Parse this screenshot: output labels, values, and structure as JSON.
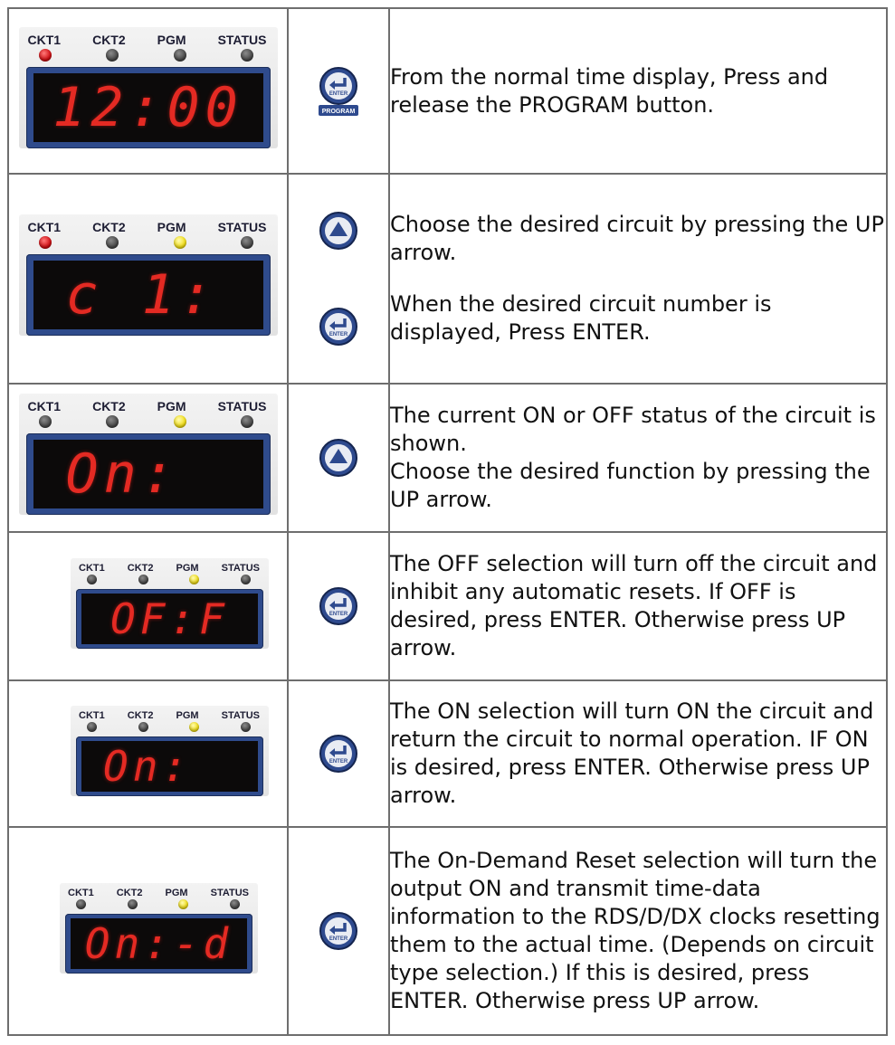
{
  "panel_labels": {
    "ckt1": "CKT1",
    "ckt2": "CKT2",
    "pgm": "PGM",
    "status": "STATUS"
  },
  "colors": {
    "led_red": "#d10f14",
    "led_yellow": "#f3e018",
    "led_off": "#4a4a4a",
    "bezel": "#2f4b8c",
    "digit_red": "#e42a23",
    "button_blue": "#2e4a8e"
  },
  "icons": {
    "enter": "enter-button-icon",
    "up": "up-arrow-button-icon",
    "program": "enter-program-button-icon"
  },
  "button_labels": {
    "enter": "ENTER",
    "program": "PROGRAM"
  },
  "steps": [
    {
      "display": "12:00",
      "leds": [
        "red",
        "off",
        "off",
        "off"
      ],
      "buttons": [
        "program"
      ],
      "text": [
        "From the normal time display, Press and release the PROGRAM button."
      ]
    },
    {
      "display": "c 1:",
      "leds": [
        "red",
        "off",
        "yellow",
        "off"
      ],
      "buttons": [
        "up",
        "enter"
      ],
      "text": [
        "Choose the desired circuit by pressing the UP arrow.",
        "When the desired circuit number is displayed, Press ENTER."
      ]
    },
    {
      "display": "On:",
      "leds": [
        "off",
        "off",
        "yellow",
        "off"
      ],
      "buttons": [
        "up"
      ],
      "text": [
        "The current ON or OFF status of the circuit is shown.",
        "Choose the desired function by pressing the UP arrow."
      ]
    },
    {
      "display": "OF:F",
      "leds": [
        "off",
        "off",
        "yellow",
        "off"
      ],
      "buttons": [
        "enter"
      ],
      "text": [
        "The OFF selection will turn off the circuit and inhibit any automatic resets.  If OFF is desired, press ENTER.  Otherwise press UP arrow."
      ]
    },
    {
      "display": "On:",
      "leds": [
        "off",
        "off",
        "yellow",
        "off"
      ],
      "buttons": [
        "enter"
      ],
      "text": [
        "The ON selection will turn ON the circuit and return the circuit to normal operation.  IF ON is desired, press ENTER.  Otherwise press UP arrow."
      ]
    },
    {
      "display": "On:-d",
      "leds": [
        "off",
        "off",
        "yellow",
        "off"
      ],
      "buttons": [
        "enter"
      ],
      "text": [
        "The On-Demand Reset selection will turn the output ON and transmit time-data information to the RDS/D/DX clocks resetting them to the actual time. (Depends on circuit type selection.) If this is desired, press ENTER.  Otherwise press UP arrow."
      ]
    }
  ]
}
